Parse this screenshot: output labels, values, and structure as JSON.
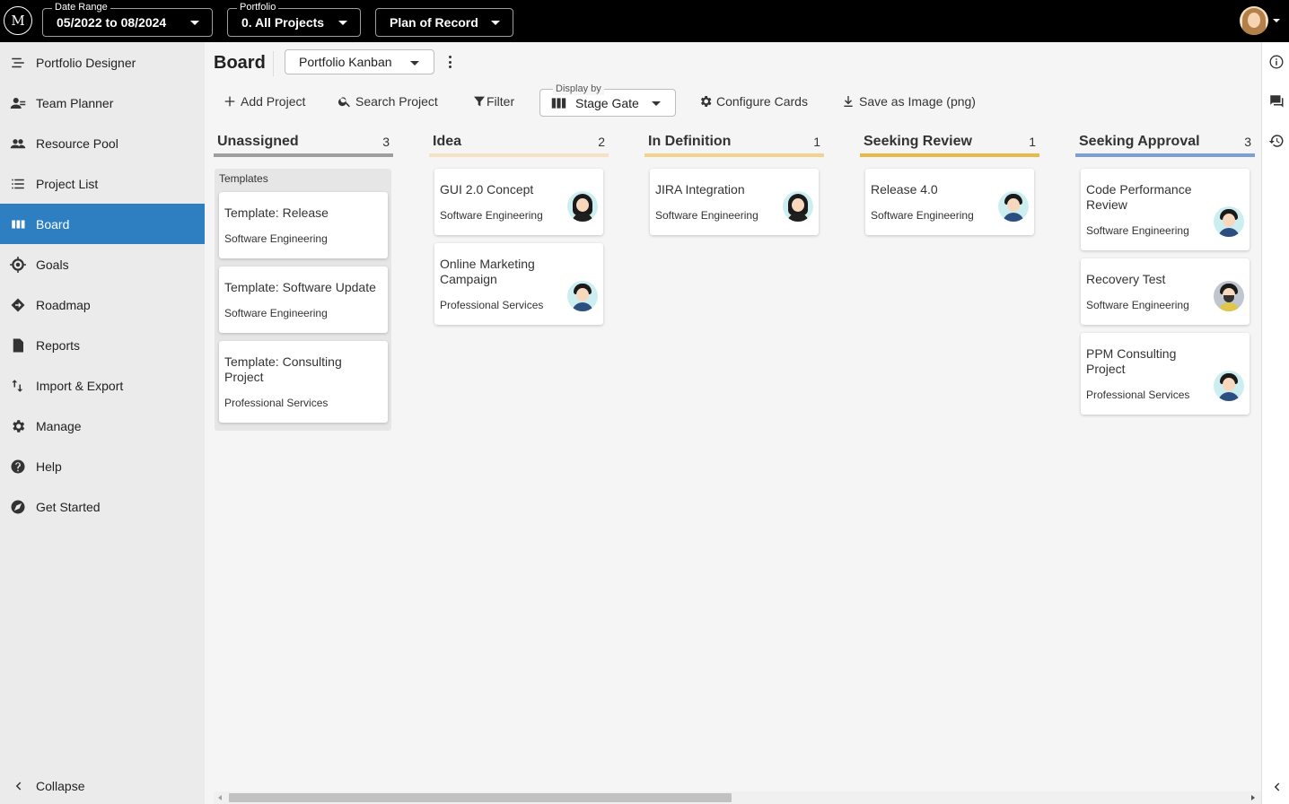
{
  "topbar": {
    "logo_text": "M",
    "date_range": {
      "label": "Date Range",
      "value": "05/2022 to 08/2024"
    },
    "portfolio": {
      "label": "Portfolio",
      "value": "0. All Projects"
    },
    "scenario": {
      "value": "Plan of Record"
    }
  },
  "sidebar": {
    "items": [
      {
        "label": "Portfolio Designer",
        "icon": "portfolio-designer-icon"
      },
      {
        "label": "Team Planner",
        "icon": "team-planner-icon"
      },
      {
        "label": "Resource Pool",
        "icon": "people-icon"
      },
      {
        "label": "Project List",
        "icon": "list-icon"
      },
      {
        "label": "Board",
        "icon": "board-icon",
        "active": true
      },
      {
        "label": "Goals",
        "icon": "target-icon"
      },
      {
        "label": "Roadmap",
        "icon": "roadmap-icon"
      },
      {
        "label": "Reports",
        "icon": "report-icon"
      },
      {
        "label": "Import & Export",
        "icon": "import-export-icon"
      },
      {
        "label": "Manage",
        "icon": "gear-icon"
      },
      {
        "label": "Help",
        "icon": "help-icon"
      },
      {
        "label": "Get Started",
        "icon": "compass-icon"
      }
    ],
    "collapse_label": "Collapse"
  },
  "board": {
    "title": "Board",
    "view": "Portfolio Kanban",
    "toolbar": {
      "add_project": "Add Project",
      "search_project": "Search Project",
      "filter": "Filter",
      "display_by_label": "Display by",
      "display_by_value": "Stage Gate",
      "configure_cards": "Configure Cards",
      "save_image": "Save as Image (png)"
    },
    "columns": [
      {
        "title": "Unassigned",
        "count": "3",
        "color": "#9e9e9e"
      },
      {
        "title": "Idea",
        "count": "2",
        "color": "#f5e2c4"
      },
      {
        "title": "In Definition",
        "count": "1",
        "color": "#f2d28e"
      },
      {
        "title": "Seeking Review",
        "count": "1",
        "color": "#e8b84a"
      },
      {
        "title": "Seeking Approval",
        "count": "3",
        "color": "#7b9fd6"
      }
    ],
    "templates_group_label": "Templates",
    "cards": {
      "unassigned": [
        {
          "title": "Template: Release",
          "subtitle": "Software Engineering"
        },
        {
          "title": "Template: Software Update",
          "subtitle": "Software Engineering"
        },
        {
          "title": "Template: Consulting Project",
          "subtitle": "Professional Services"
        }
      ],
      "idea": [
        {
          "title": "GUI 2.0 Concept",
          "subtitle": "Software Engineering"
        },
        {
          "title": "Online Marketing Campaign",
          "subtitle": "Professional Services"
        }
      ],
      "in_definition": [
        {
          "title": "JIRA Integration",
          "subtitle": "Software Engineering"
        }
      ],
      "seeking_review": [
        {
          "title": "Release 4.0",
          "subtitle": "Software Engineering"
        }
      ],
      "seeking_approval": [
        {
          "title": "Code Performance Review",
          "subtitle": "Software Engineering"
        },
        {
          "title": "Recovery Test",
          "subtitle": "Software Engineering"
        },
        {
          "title": "PPM Consulting Project",
          "subtitle": "Professional Services"
        }
      ]
    }
  },
  "rail": {
    "icons": [
      "info-icon",
      "comments-icon",
      "history-icon"
    ]
  }
}
